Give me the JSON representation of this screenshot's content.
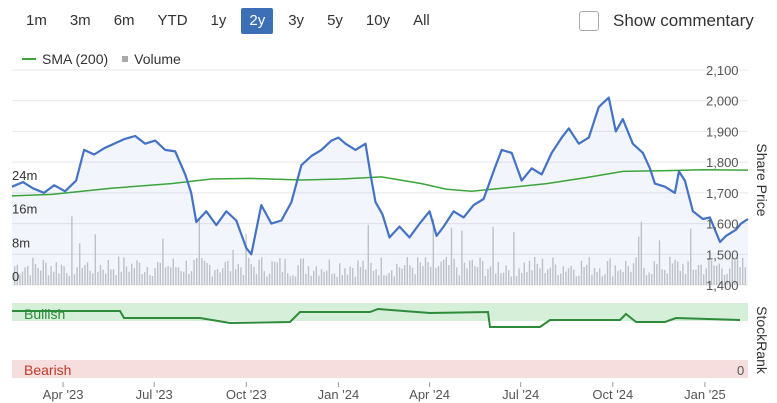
{
  "range_buttons": [
    {
      "label": "1m",
      "active": false
    },
    {
      "label": "3m",
      "active": false
    },
    {
      "label": "6m",
      "active": false
    },
    {
      "label": "YTD",
      "active": false
    },
    {
      "label": "1y",
      "active": false
    },
    {
      "label": "2y",
      "active": true
    },
    {
      "label": "3y",
      "active": false
    },
    {
      "label": "5y",
      "active": false
    },
    {
      "label": "10y",
      "active": false
    },
    {
      "label": "All",
      "active": false
    }
  ],
  "commentary": {
    "label": "Show commentary",
    "checked": false
  },
  "legend": {
    "sma_label": "SMA (200)",
    "volume_label": "Volume"
  },
  "colors": {
    "accent": "#3d6fb6",
    "price_line": "#4472c4",
    "sma_line": "#3aa53a",
    "volume_bars": "#c8c8c8",
    "bullish_band": "#d6efd9",
    "bearish_band": "#f7dede",
    "bullish_text": "#2e8b3a",
    "bearish_text": "#c0392b"
  },
  "chart_data": {
    "type": "line",
    "x_ticks": [
      "Apr '23",
      "Jul '23",
      "Oct '23",
      "Jan '24",
      "Apr '24",
      "Jul '24",
      "Oct '24",
      "Jan '25"
    ],
    "y_ticks": [
      "2,100",
      "2,000",
      "1,900",
      "1,800",
      "1,700",
      "1,600",
      "1,500",
      "1,400"
    ],
    "ylim": [
      1400,
      2100
    ],
    "ylabel": "Share Price",
    "volume_ticks": [
      "24m",
      "16m",
      "8m",
      "0"
    ],
    "volume_lim": [
      0,
      28
    ],
    "series": [
      {
        "name": "Share Price",
        "points": [
          [
            "2023-02-09",
            1720
          ],
          [
            "2023-02-20",
            1735
          ],
          [
            "2023-03-02",
            1715
          ],
          [
            "2023-03-13",
            1700
          ],
          [
            "2023-03-23",
            1725
          ],
          [
            "2023-04-03",
            1705
          ],
          [
            "2023-04-14",
            1740
          ],
          [
            "2023-04-22",
            1840
          ],
          [
            "2023-05-02",
            1825
          ],
          [
            "2023-05-12",
            1845
          ],
          [
            "2023-05-22",
            1860
          ],
          [
            "2023-06-01",
            1875
          ],
          [
            "2023-06-12",
            1885
          ],
          [
            "2023-06-22",
            1860
          ],
          [
            "2023-07-02",
            1870
          ],
          [
            "2023-07-12",
            1840
          ],
          [
            "2023-07-22",
            1835
          ],
          [
            "2023-08-01",
            1760
          ],
          [
            "2023-08-07",
            1700
          ],
          [
            "2023-08-12",
            1605
          ],
          [
            "2023-08-22",
            1640
          ],
          [
            "2023-09-01",
            1595
          ],
          [
            "2023-09-11",
            1640
          ],
          [
            "2023-09-21",
            1610
          ],
          [
            "2023-10-01",
            1520
          ],
          [
            "2023-10-06",
            1500
          ],
          [
            "2023-10-16",
            1660
          ],
          [
            "2023-10-26",
            1600
          ],
          [
            "2023-11-05",
            1610
          ],
          [
            "2023-11-15",
            1670
          ],
          [
            "2023-11-25",
            1790
          ],
          [
            "2023-12-05",
            1820
          ],
          [
            "2023-12-15",
            1840
          ],
          [
            "2023-12-25",
            1870
          ],
          [
            "2024-01-01",
            1880
          ],
          [
            "2024-01-08",
            1860
          ],
          [
            "2024-01-18",
            1840
          ],
          [
            "2024-01-28",
            1860
          ],
          [
            "2024-02-02",
            1760
          ],
          [
            "2024-02-07",
            1670
          ],
          [
            "2024-02-14",
            1630
          ],
          [
            "2024-02-21",
            1555
          ],
          [
            "2024-03-02",
            1590
          ],
          [
            "2024-03-12",
            1555
          ],
          [
            "2024-03-22",
            1600
          ],
          [
            "2024-04-01",
            1640
          ],
          [
            "2024-04-08",
            1560
          ],
          [
            "2024-04-15",
            1590
          ],
          [
            "2024-04-25",
            1640
          ],
          [
            "2024-05-05",
            1620
          ],
          [
            "2024-05-15",
            1660
          ],
          [
            "2024-05-25",
            1680
          ],
          [
            "2024-06-05",
            1780
          ],
          [
            "2024-06-12",
            1840
          ],
          [
            "2024-06-22",
            1830
          ],
          [
            "2024-07-02",
            1740
          ],
          [
            "2024-07-12",
            1780
          ],
          [
            "2024-07-22",
            1760
          ],
          [
            "2024-08-01",
            1830
          ],
          [
            "2024-08-11",
            1880
          ],
          [
            "2024-08-18",
            1910
          ],
          [
            "2024-08-28",
            1860
          ],
          [
            "2024-09-07",
            1880
          ],
          [
            "2024-09-17",
            1980
          ],
          [
            "2024-09-27",
            2010
          ],
          [
            "2024-10-04",
            1900
          ],
          [
            "2024-10-11",
            1940
          ],
          [
            "2024-10-21",
            1860
          ],
          [
            "2024-10-31",
            1830
          ],
          [
            "2024-11-07",
            1780
          ],
          [
            "2024-11-12",
            1730
          ],
          [
            "2024-11-22",
            1720
          ],
          [
            "2024-12-02",
            1700
          ],
          [
            "2024-12-06",
            1770
          ],
          [
            "2024-12-12",
            1740
          ],
          [
            "2024-12-20",
            1640
          ],
          [
            "2024-12-30",
            1615
          ],
          [
            "2025-01-06",
            1620
          ],
          [
            "2025-01-16",
            1540
          ],
          [
            "2025-01-22",
            1560
          ],
          [
            "2025-02-01",
            1580
          ],
          [
            "2025-02-06",
            1600
          ],
          [
            "2025-02-13",
            1615
          ]
        ]
      },
      {
        "name": "SMA (200)",
        "points": [
          [
            "2023-02-09",
            1690
          ],
          [
            "2023-03-21",
            1695
          ],
          [
            "2023-05-19",
            1715
          ],
          [
            "2023-07-18",
            1730
          ],
          [
            "2023-08-27",
            1745
          ],
          [
            "2023-10-06",
            1747
          ],
          [
            "2023-11-25",
            1742
          ],
          [
            "2024-01-04",
            1745
          ],
          [
            "2024-02-13",
            1752
          ],
          [
            "2024-03-24",
            1730
          ],
          [
            "2024-04-18",
            1712
          ],
          [
            "2024-05-13",
            1705
          ],
          [
            "2024-06-12",
            1715
          ],
          [
            "2024-07-27",
            1730
          ],
          [
            "2024-09-05",
            1750
          ],
          [
            "2024-10-11",
            1770
          ],
          [
            "2024-11-20",
            1772
          ],
          [
            "2024-12-30",
            1775
          ],
          [
            "2025-02-13",
            1774
          ]
        ]
      }
    ]
  }
}
